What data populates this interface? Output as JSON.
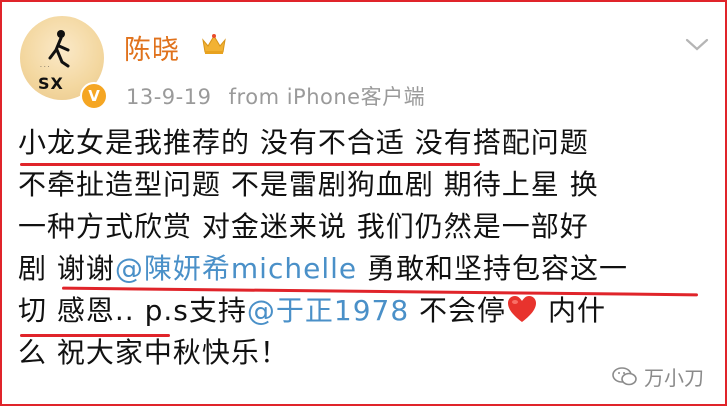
{
  "profile": {
    "avatar_text": "SX",
    "avatar_small_text": "· · ·",
    "verified_badge": "V",
    "name": "陈晓",
    "crown_icon": "crown-icon",
    "date": "13-9-19",
    "source": "from iPhone客户端"
  },
  "post": {
    "lines": [
      "小龙女是我推荐的 没有不合适 没有搭配问题",
      "不牵扯造型问题 不是雷剧狗血剧 期待上星 换",
      "一种方式欣赏 对金迷来说 我们仍然是一部好"
    ],
    "line4_prefix": "剧 谢谢",
    "mention1": "@陳妍希michelle",
    "line4_suffix": " 勇敢和坚持包容这一",
    "line5_prefix": "切 感恩.. p.s支持",
    "mention2": "@于正1978",
    "line5_suffix": " 不会停",
    "line5_after_heart": " 内什",
    "line6": "么 祝大家中秋快乐！"
  },
  "watermark": {
    "text": "万小刀",
    "icon": "wechat-icon"
  },
  "colors": {
    "frame": "#e0242a",
    "name": "#e0721c",
    "mention": "#4a90c8",
    "underline": "#e0242a",
    "meta": "#9a9a9a"
  }
}
